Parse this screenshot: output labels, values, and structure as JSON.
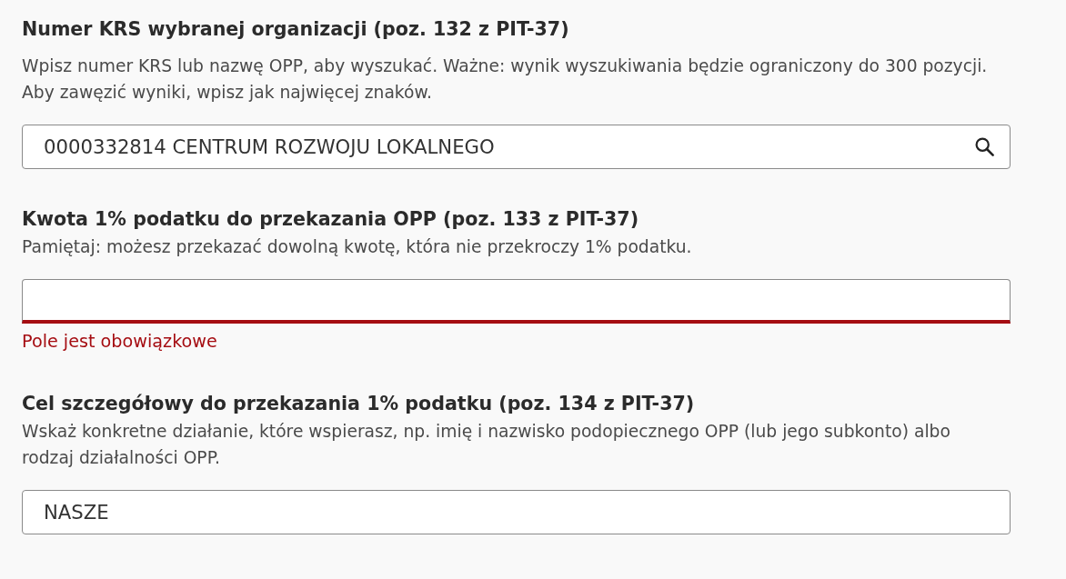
{
  "fields": [
    {
      "kind": "search",
      "label": "Numer KRS wybranej organizacji (poz. 132 z PIT-37)",
      "hint": "Wpisz numer KRS lub nazwę OPP, aby wyszukać. Ważne: wynik wyszukiwania będzie ograniczony do 300 pozycji. Aby zawęzić wyniki, wpisz jak najwięcej znaków.",
      "value": "0000332814 CENTRUM ROZWOJU LOKALNEGO",
      "invalid": false
    },
    {
      "kind": "text",
      "label": "Kwota 1% podatku do przekazania OPP (poz. 133 z PIT-37)",
      "hint": "Pamiętaj: możesz przekazać dowolną kwotę, która nie przekroczy 1% podatku.",
      "invalid": true,
      "error": "Pole jest obowiązkowe"
    },
    {
      "kind": "text",
      "label": "Cel szczegółowy do przekazania 1% podatku (poz. 134 z PIT-37)",
      "hint": "Wskaż konkretne działanie, które wspierasz, np. imię i nazwisko podopiecznego OPP (lub jego subkonto) albo rodzaj działalności OPP.",
      "value": "NASZE",
      "invalid": false
    }
  ]
}
